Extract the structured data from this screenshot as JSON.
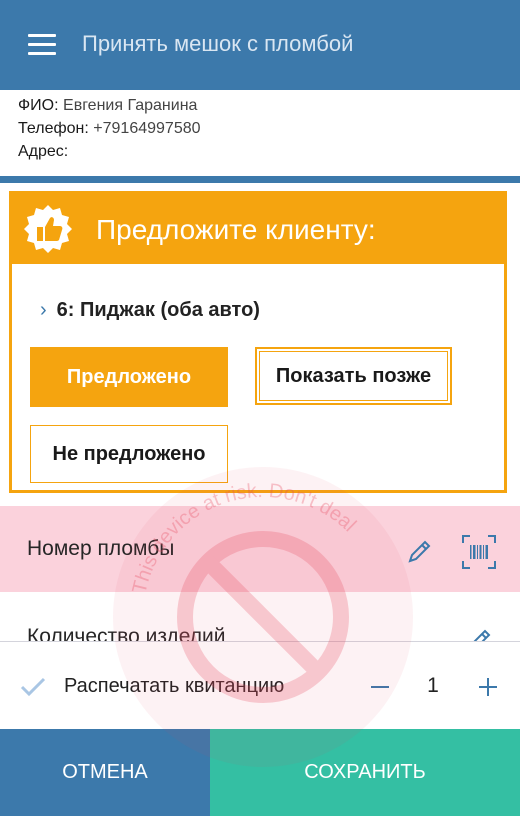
{
  "header": {
    "title": "Принять мешок с пломбой"
  },
  "client": {
    "name_label": "ФИО:",
    "name_value": "Евгения Гаранина",
    "phone_label": "Телефон:",
    "phone_value": "+79164997580",
    "address_label": "Адрес:",
    "address_value": ""
  },
  "offer": {
    "title": "Предложите клиенту:",
    "item_chevron": "›",
    "item": "6: Пиджак (оба авто)",
    "offered_label": "Предложено",
    "later_label": "Показать позже",
    "not_offered_label": "Не предложено"
  },
  "form": {
    "seal_label": "Номер пломбы",
    "quantity_label": "Количество изделий"
  },
  "print": {
    "label": "Распечатать квитанцию",
    "minus": "−",
    "count": "1",
    "plus": "+"
  },
  "footer": {
    "cancel_label": "ОТМЕНА",
    "save_label": "СОХРАНИТЬ"
  },
  "watermark": {
    "text": "This device at risk. Don't deal"
  },
  "colors": {
    "primary": "#3c79ab",
    "accent": "#f5a40f",
    "save": "#34bfa3",
    "alert_row": "#fbd2dc",
    "watermark": "#e84a5f"
  },
  "icons": [
    "menu-icon",
    "thumbs-up-badge-icon",
    "chevron-right-icon",
    "edit-pencil-icon",
    "barcode-scan-icon",
    "check-icon",
    "minus-icon",
    "plus-icon",
    "no-sign-icon"
  ]
}
